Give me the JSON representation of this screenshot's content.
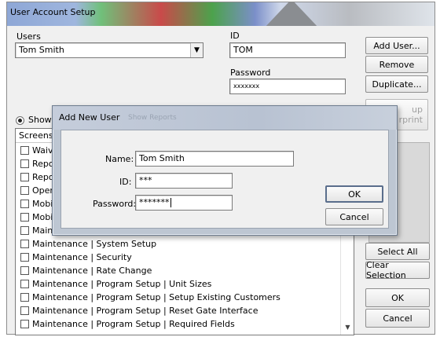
{
  "window": {
    "title": "User Account Setup",
    "users_label": "Users",
    "selected_user": "Tom Smith",
    "id_label": "ID",
    "id_value": "TOM",
    "password_label": "Password",
    "password_value": "xxxxxxx",
    "show_label": "Show",
    "screens_header": "Screens",
    "buttons": {
      "add_user": "Add User...",
      "remove": "Remove",
      "duplicate": "Duplicate...",
      "setup_partial": "up",
      "setup_partial_2": "rprint",
      "select_all": "Select All",
      "clear_selection": "Clear Selection",
      "ok": "OK",
      "cancel": "Cancel"
    },
    "screens": [
      "Waiv",
      "Repo",
      "Repo",
      "Open",
      "Mobi",
      "Mobi",
      "Main",
      "Maintenance | System Setup",
      "Maintenance | Security",
      "Maintenance | Rate Change",
      "Maintenance | Program Setup | Unit Sizes",
      "Maintenance | Program Setup | Setup Existing Customers",
      "Maintenance | Program Setup | Reset Gate Interface",
      "Maintenance | Program Setup | Required Fields"
    ]
  },
  "dialog": {
    "title": "Add New User",
    "ghost_text": "Show Reports",
    "name_label": "Name:",
    "name_value": "Tom Smith",
    "id_label": "ID:",
    "id_value": "***",
    "password_label": "Password:",
    "password_value": "*******",
    "ok": "OK",
    "cancel": "Cancel"
  }
}
